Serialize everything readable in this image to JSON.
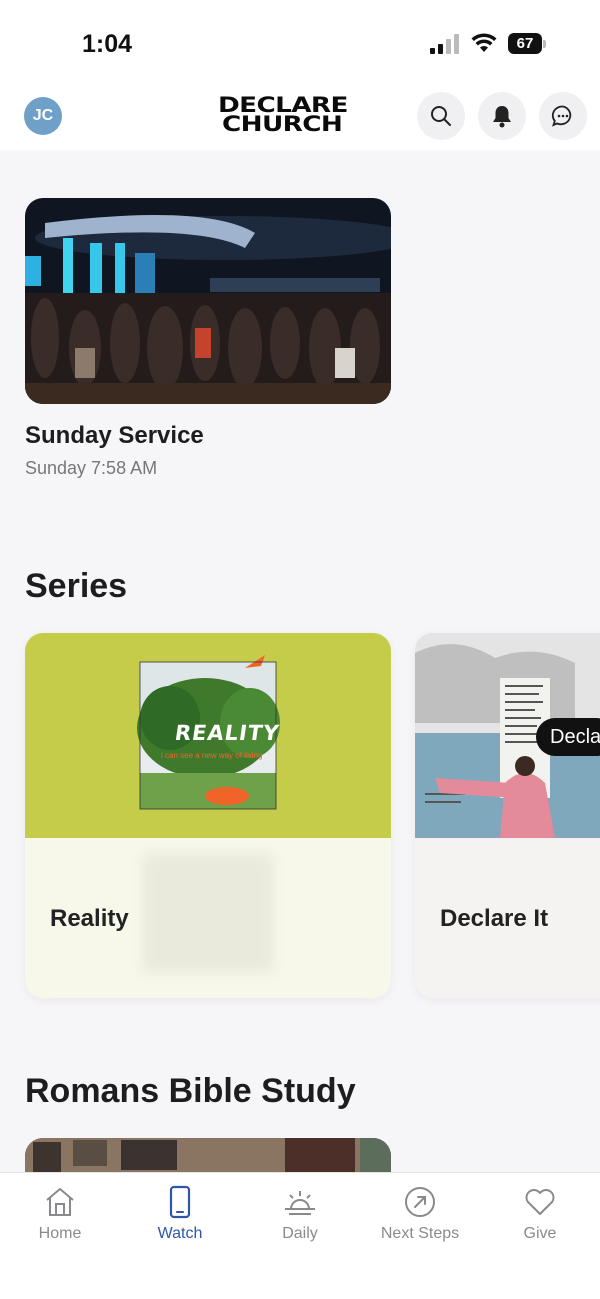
{
  "status_bar": {
    "time": "1:04",
    "battery": "67"
  },
  "header": {
    "avatar_initials": "JC",
    "logo_line1": "DECLARE",
    "logo_line2": "CHURCH",
    "icons": [
      "search-icon",
      "bell-icon",
      "chat-icon"
    ]
  },
  "featured": {
    "title": "Sunday Service",
    "subtitle": "Sunday 7:58 AM"
  },
  "series": {
    "heading": "Series",
    "items": [
      {
        "label": "Reality",
        "art_text": "REALITY",
        "art_subtext": "i can see a new way of living",
        "accent": "#c5cc4a"
      },
      {
        "label": "Declare It",
        "overlay": "Decla"
      }
    ]
  },
  "romans": {
    "heading": "Romans Bible Study"
  },
  "tabbar": {
    "tabs": [
      {
        "label": "Home",
        "icon": "home-icon"
      },
      {
        "label": "Watch",
        "icon": "phone-icon",
        "active": true
      },
      {
        "label": "Daily",
        "icon": "sunrise-icon"
      },
      {
        "label": "Next Steps",
        "icon": "arrow-circle-icon"
      },
      {
        "label": "Give",
        "icon": "heart-icon"
      }
    ],
    "active_color": "#2f56a6"
  }
}
